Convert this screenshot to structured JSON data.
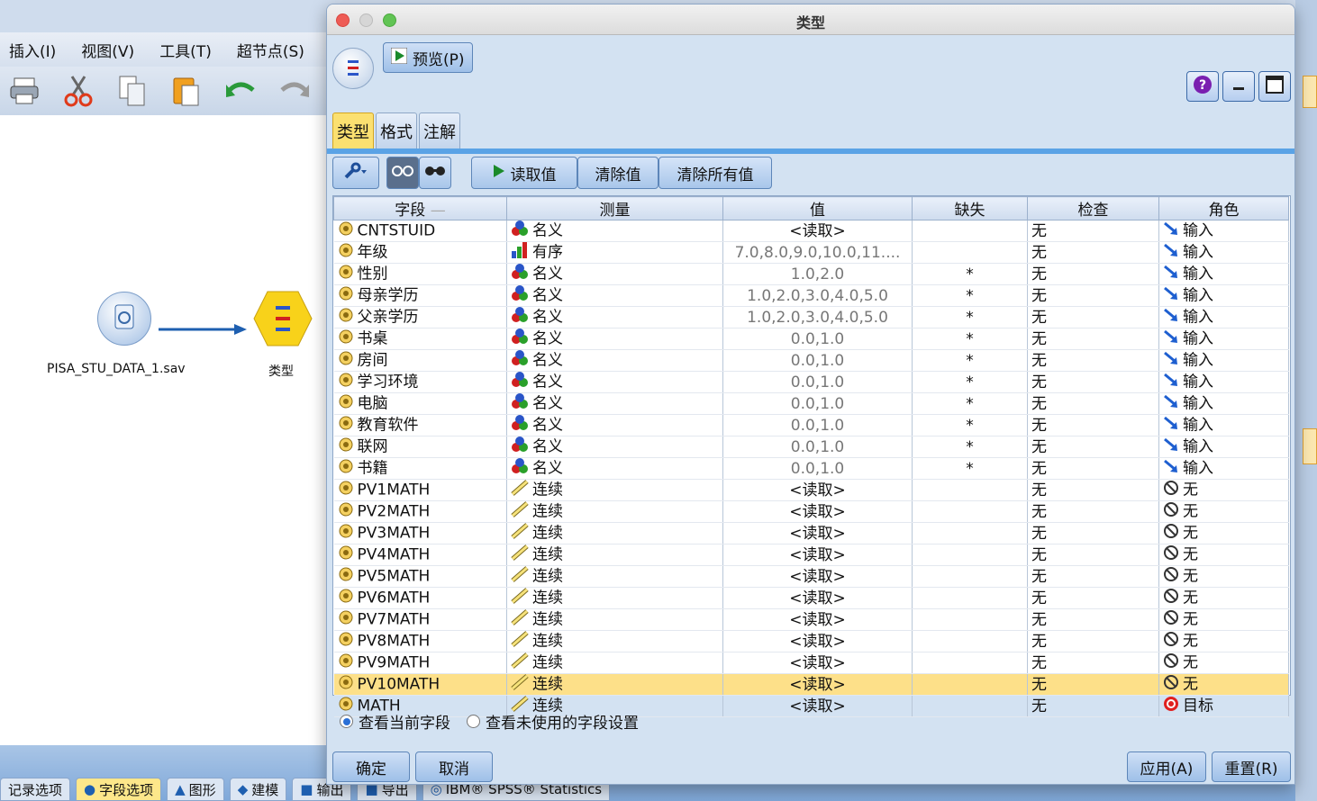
{
  "background_app": {
    "menu": [
      "插入(I)",
      "视图(V)",
      "工具(T)",
      "超节点(S)"
    ],
    "toolbar_icons": [
      "print-icon",
      "cut-icon",
      "copy-icon",
      "paste-icon",
      "undo-icon",
      "redo-icon"
    ],
    "stream": {
      "source_node_label": "PISA_STU_DATA_1.sav",
      "type_node_label": "类型"
    },
    "bottom_tabs": [
      "记录选项",
      "字段选项",
      "图形",
      "建模",
      "输出",
      "导出",
      "IBM® SPSS® Statistics"
    ],
    "active_bottom_tab": "字段选项"
  },
  "dialog": {
    "title": "类型",
    "preview_label": "预览(P)",
    "tabs": [
      "类型",
      "格式",
      "注解"
    ],
    "active_tab": "类型",
    "actions": {
      "read_values": "读取值",
      "clear_values": "清除值",
      "clear_all_values": "清除所有值"
    },
    "columns": [
      "字段",
      "测量",
      "值",
      "缺失",
      "检查",
      "角色"
    ],
    "rows": [
      {
        "field": "CNTSTUID",
        "measure": "名义",
        "measure_icon": "nominal-icon",
        "value": "<读取>",
        "missing": "",
        "check": "无",
        "role": "输入",
        "role_icon": "input-arrow-icon"
      },
      {
        "field": "年级",
        "measure": "有序",
        "measure_icon": "ordinal-icon",
        "value": "7.0,8.0,9.0,10.0,11....",
        "missing": "",
        "check": "无",
        "role": "输入",
        "role_icon": "input-arrow-icon"
      },
      {
        "field": "性别",
        "measure": "名义",
        "measure_icon": "nominal-icon",
        "value": "1.0,2.0",
        "missing": "*",
        "check": "无",
        "role": "输入",
        "role_icon": "input-arrow-icon"
      },
      {
        "field": "母亲学历",
        "measure": "名义",
        "measure_icon": "nominal-icon",
        "value": "1.0,2.0,3.0,4.0,5.0",
        "missing": "*",
        "check": "无",
        "role": "输入",
        "role_icon": "input-arrow-icon"
      },
      {
        "field": "父亲学历",
        "measure": "名义",
        "measure_icon": "nominal-icon",
        "value": "1.0,2.0,3.0,4.0,5.0",
        "missing": "*",
        "check": "无",
        "role": "输入",
        "role_icon": "input-arrow-icon"
      },
      {
        "field": "书桌",
        "measure": "名义",
        "measure_icon": "nominal-icon",
        "value": "0.0,1.0",
        "missing": "*",
        "check": "无",
        "role": "输入",
        "role_icon": "input-arrow-icon"
      },
      {
        "field": "房间",
        "measure": "名义",
        "measure_icon": "nominal-icon",
        "value": "0.0,1.0",
        "missing": "*",
        "check": "无",
        "role": "输入",
        "role_icon": "input-arrow-icon"
      },
      {
        "field": "学习环境",
        "measure": "名义",
        "measure_icon": "nominal-icon",
        "value": "0.0,1.0",
        "missing": "*",
        "check": "无",
        "role": "输入",
        "role_icon": "input-arrow-icon"
      },
      {
        "field": "电脑",
        "measure": "名义",
        "measure_icon": "nominal-icon",
        "value": "0.0,1.0",
        "missing": "*",
        "check": "无",
        "role": "输入",
        "role_icon": "input-arrow-icon"
      },
      {
        "field": "教育软件",
        "measure": "名义",
        "measure_icon": "nominal-icon",
        "value": "0.0,1.0",
        "missing": "*",
        "check": "无",
        "role": "输入",
        "role_icon": "input-arrow-icon"
      },
      {
        "field": "联网",
        "measure": "名义",
        "measure_icon": "nominal-icon",
        "value": "0.0,1.0",
        "missing": "*",
        "check": "无",
        "role": "输入",
        "role_icon": "input-arrow-icon"
      },
      {
        "field": "书籍",
        "measure": "名义",
        "measure_icon": "nominal-icon",
        "value": "0.0,1.0",
        "missing": "*",
        "check": "无",
        "role": "输入",
        "role_icon": "input-arrow-icon"
      },
      {
        "field": "PV1MATH",
        "measure": "连续",
        "measure_icon": "continuous-ruler-icon",
        "value": "<读取>",
        "missing": "",
        "check": "无",
        "role": "无",
        "role_icon": "none-circle-icon"
      },
      {
        "field": "PV2MATH",
        "measure": "连续",
        "measure_icon": "continuous-ruler-icon",
        "value": "<读取>",
        "missing": "",
        "check": "无",
        "role": "无",
        "role_icon": "none-circle-icon"
      },
      {
        "field": "PV3MATH",
        "measure": "连续",
        "measure_icon": "continuous-ruler-icon",
        "value": "<读取>",
        "missing": "",
        "check": "无",
        "role": "无",
        "role_icon": "none-circle-icon"
      },
      {
        "field": "PV4MATH",
        "measure": "连续",
        "measure_icon": "continuous-ruler-icon",
        "value": "<读取>",
        "missing": "",
        "check": "无",
        "role": "无",
        "role_icon": "none-circle-icon"
      },
      {
        "field": "PV5MATH",
        "measure": "连续",
        "measure_icon": "continuous-ruler-icon",
        "value": "<读取>",
        "missing": "",
        "check": "无",
        "role": "无",
        "role_icon": "none-circle-icon"
      },
      {
        "field": "PV6MATH",
        "measure": "连续",
        "measure_icon": "continuous-ruler-icon",
        "value": "<读取>",
        "missing": "",
        "check": "无",
        "role": "无",
        "role_icon": "none-circle-icon"
      },
      {
        "field": "PV7MATH",
        "measure": "连续",
        "measure_icon": "continuous-ruler-icon",
        "value": "<读取>",
        "missing": "",
        "check": "无",
        "role": "无",
        "role_icon": "none-circle-icon"
      },
      {
        "field": "PV8MATH",
        "measure": "连续",
        "measure_icon": "continuous-ruler-icon",
        "value": "<读取>",
        "missing": "",
        "check": "无",
        "role": "无",
        "role_icon": "none-circle-icon"
      },
      {
        "field": "PV9MATH",
        "measure": "连续",
        "measure_icon": "continuous-ruler-icon",
        "value": "<读取>",
        "missing": "",
        "check": "无",
        "role": "无",
        "role_icon": "none-circle-icon"
      },
      {
        "field": "PV10MATH",
        "measure": "连续",
        "measure_icon": "continuous-ruler-icon",
        "value": "<读取>",
        "missing": "",
        "check": "无",
        "role": "无",
        "role_icon": "none-circle-icon",
        "selected": true
      },
      {
        "field": "MATH",
        "measure": "连续",
        "measure_icon": "continuous-ruler-icon",
        "value": "<读取>",
        "missing": "",
        "check": "无",
        "role": "目标",
        "role_icon": "target-icon"
      }
    ],
    "view_options": {
      "current": "查看当前字段",
      "unused": "查看未使用的字段设置",
      "selected": "current"
    },
    "buttons": {
      "ok": "确定",
      "cancel": "取消",
      "apply": "应用(A)",
      "reset": "重置(R)"
    },
    "colors": {
      "selected_row": "#fde089",
      "active_tab": "#fbe070",
      "accent_blue": "#5aa3e6"
    }
  }
}
